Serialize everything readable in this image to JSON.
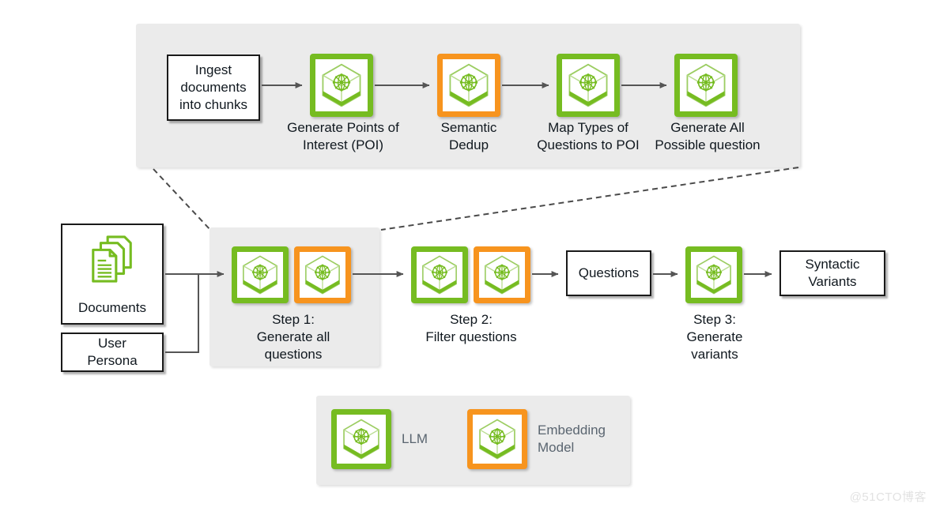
{
  "colors": {
    "llm_green": "#76bc21",
    "embedding_orange": "#f7941e",
    "panel_gray": "#ebebeb",
    "box_border": "#1a1a1a",
    "text": "#10181f",
    "legend_text": "#5a6570",
    "arrow": "#555555",
    "dashed": "#4a4a4a"
  },
  "detail_panel": {
    "name": "expanded-step-1-detail",
    "ingest_box": {
      "label": "Ingest\ndocuments\ninto chunks"
    },
    "stages": [
      {
        "label": "Generate Points of\nInterest (POI)",
        "model": "LLM",
        "accent": "#76bc21",
        "icon": "cube-network-icon"
      },
      {
        "label": "Semantic\nDedup",
        "model": "Embedding Model",
        "accent": "#f7941e",
        "icon": "cube-network-icon"
      },
      {
        "label": "Map Types of\nQuestions to POI",
        "model": "LLM",
        "accent": "#76bc21",
        "icon": "cube-network-icon"
      },
      {
        "label": "Generate All\nPossible question",
        "model": "LLM",
        "accent": "#76bc21",
        "icon": "cube-network-icon"
      }
    ]
  },
  "pipeline": {
    "inputs": [
      {
        "label": "Documents",
        "icon": "documents-icon"
      },
      {
        "label": "User\nPersona",
        "icon": null
      }
    ],
    "steps": [
      {
        "caption": "Step 1:\nGenerate all\nquestions",
        "boxed": true,
        "tiles": [
          {
            "model": "LLM",
            "accent": "#76bc21",
            "icon": "cube-network-icon"
          },
          {
            "model": "Embedding Model",
            "accent": "#f7941e",
            "icon": "cube-network-icon"
          }
        ]
      },
      {
        "caption": "Step 2:\nFilter questions",
        "boxed": false,
        "tiles": [
          {
            "model": "LLM",
            "accent": "#76bc21",
            "icon": "cube-network-icon"
          },
          {
            "model": "Embedding Model",
            "accent": "#f7941e",
            "icon": "cube-network-icon"
          }
        ]
      },
      {
        "caption": "Step 3:\nGenerate\nvariants",
        "boxed": false,
        "tiles": [
          {
            "model": "LLM",
            "accent": "#76bc21",
            "icon": "cube-network-icon"
          }
        ]
      }
    ],
    "intermediate_output": {
      "label": "Questions"
    },
    "final_output": {
      "label": "Syntactic\nVariants"
    }
  },
  "legend": {
    "items": [
      {
        "label": "LLM",
        "accent": "#76bc21",
        "icon": "cube-network-icon"
      },
      {
        "label": "Embedding\nModel",
        "accent": "#f7941e",
        "icon": "cube-network-icon"
      }
    ]
  },
  "watermark": {
    "text": "@51CTO博客"
  }
}
